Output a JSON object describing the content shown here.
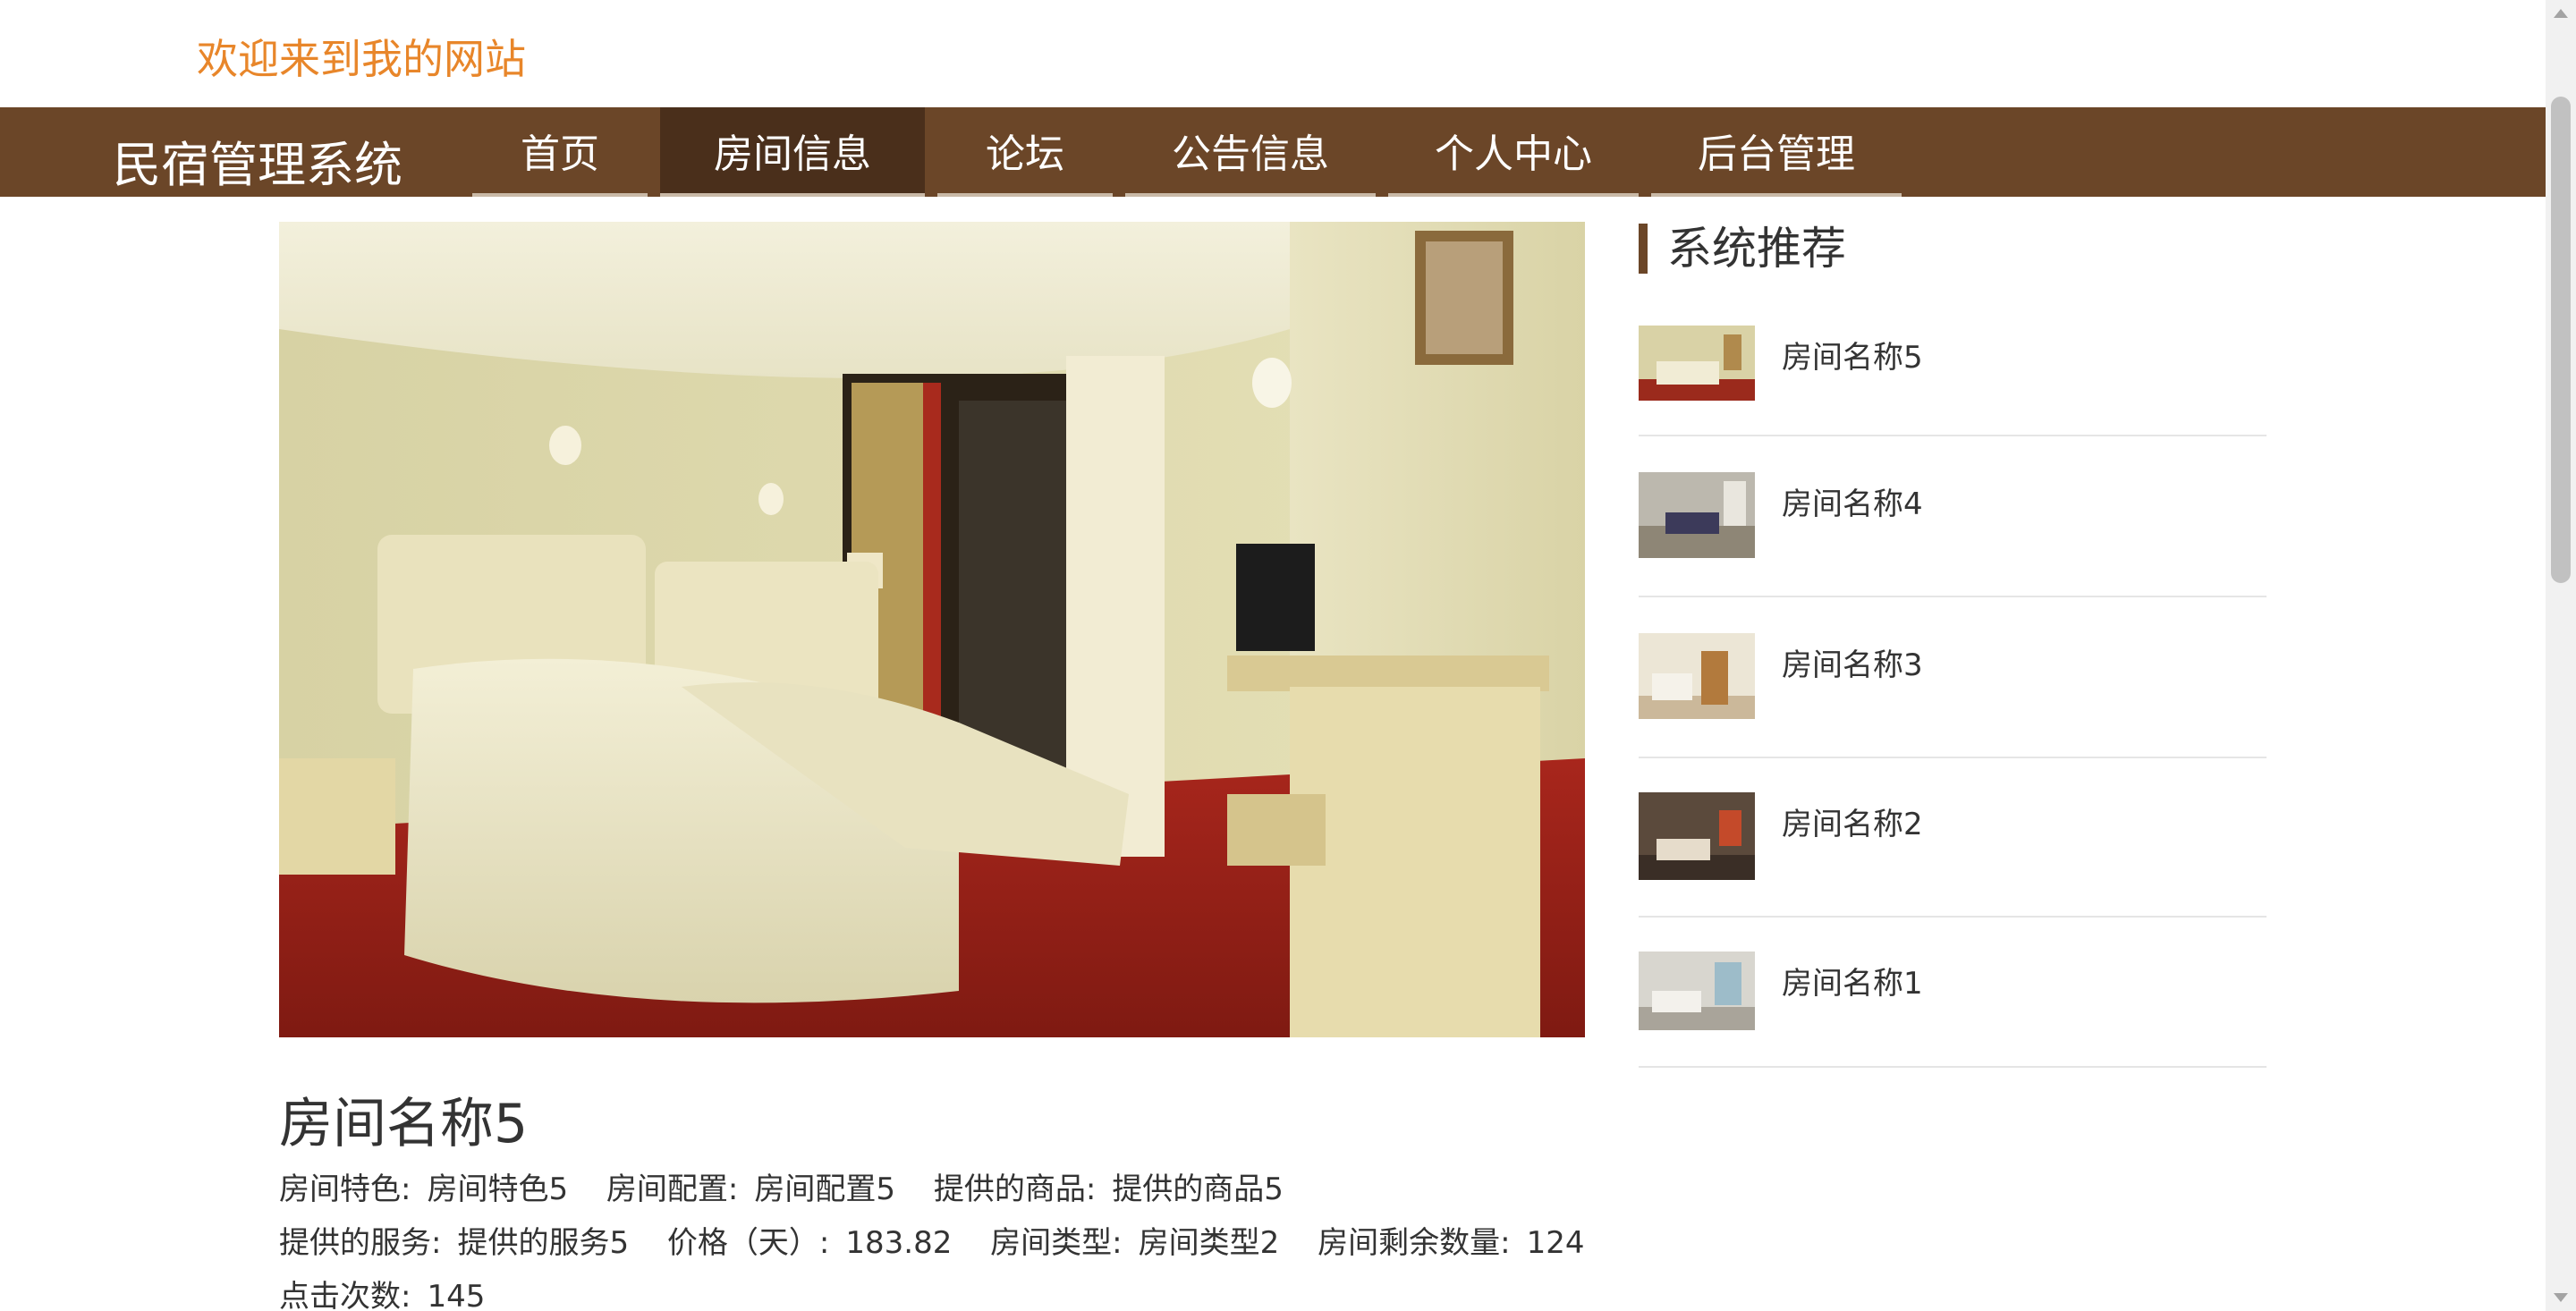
{
  "welcome": "欢迎来到我的网站",
  "brand": "民宿管理系统",
  "nav": [
    "首页",
    "房间信息",
    "论坛",
    "公告信息",
    "个人中心",
    "后台管理"
  ],
  "nav_active_index": 1,
  "room": {
    "title": "房间名称5",
    "line1": [
      {
        "label": "房间特色:",
        "value": "房间特色5"
      },
      {
        "label": "房间配置:",
        "value": "房间配置5"
      },
      {
        "label": "提供的商品:",
        "value": "提供的商品5"
      }
    ],
    "line2": [
      {
        "label": "提供的服务:",
        "value": "提供的服务5"
      },
      {
        "label": "价格（天）:",
        "value": "183.82"
      },
      {
        "label": "房间类型:",
        "value": "房间类型2"
      },
      {
        "label": "房间剩余数量:",
        "value": "124"
      }
    ],
    "line3": [
      {
        "label": "点击次数:",
        "value": "145"
      }
    ]
  },
  "sidebar": {
    "title": "系统推荐",
    "items": [
      "房间名称5",
      "房间名称4",
      "房间名称3",
      "房间名称2",
      "房间名称1"
    ]
  },
  "colors": {
    "nav_bg": "#6b4628",
    "nav_active": "#4a2f1b",
    "welcome": "#e8862a",
    "accent_bar": "#6b4628"
  },
  "icons": {
    "scroll_up": "triangle-up",
    "scroll_down": "triangle-down"
  }
}
